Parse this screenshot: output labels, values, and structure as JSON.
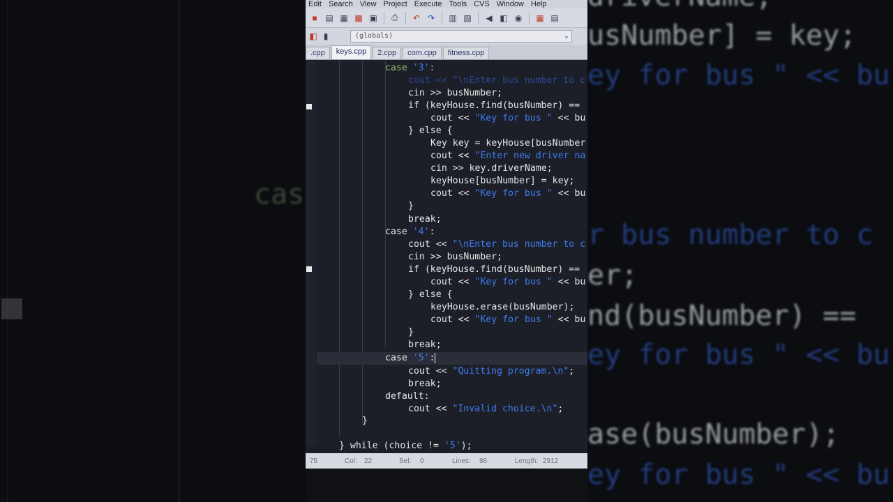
{
  "menu": {
    "items": [
      "Edit",
      "Search",
      "View",
      "Project",
      "Execute",
      "Tools",
      "CVS",
      "Window",
      "Help"
    ]
  },
  "toolbar": {
    "icons": [
      "new-file-icon",
      "open-icon",
      "save-icon",
      "save-all-icon",
      "close-icon",
      "print-icon",
      "undo-icon",
      "redo-icon",
      "indent-icon",
      "unindent-icon",
      "toggle-comment-icon",
      "find-icon",
      "compile-icon",
      "run-icon"
    ]
  },
  "classbar": {
    "scope": "(globals)"
  },
  "tabs": [
    {
      "label": ".cpp",
      "active": false
    },
    {
      "label": "keys.cpp",
      "active": true
    },
    {
      "label": "2.cpp",
      "active": false
    },
    {
      "label": "com.cpp",
      "active": false
    },
    {
      "label": "fitness.cpp",
      "active": false
    }
  ],
  "code": {
    "lines": [
      "case '3':",
      "cout << \"\\nEnter bus number to c",
      "cin >> busNumber;",
      "if (keyHouse.find(busNumber) ==",
      "cout << \"Key for bus \" << bu",
      "} else {",
      "Key key = keyHouse[busNumber",
      "cout << \"Enter new driver na",
      "cin >> key.driverName;",
      "keyHouse[busNumber] = key;",
      "cout << \"Key for bus \" << bu",
      "}",
      "break;",
      "case '4':",
      "cout << \"\\nEnter bus number to c",
      "cin >> busNumber;",
      "if (keyHouse.find(busNumber) ==",
      "cout << \"Key for bus \" << bu",
      "} else {",
      "keyHouse.erase(busNumber);",
      "cout << \"Key for bus \" << bu",
      "}",
      "break;",
      "case '5':",
      "cout << \"Quitting program.\\n\";",
      "break;",
      "default:",
      "cout << \"Invalid choice.\\n\";",
      "}",
      "} while (choice != '5');"
    ]
  },
  "status": {
    "line": "75",
    "col_label": "Col:",
    "col": "22",
    "sel_label": "Sel:",
    "sel": "0",
    "lines_label": "Lines:",
    "lines": "86",
    "length_label": "Length:",
    "length": "2912"
  },
  "background": {
    "left_text": "cas",
    "right_lines": [
      "driverName;",
      "usNumber] = key;",
      "ey for bus \" << bu",
      "r bus number to c",
      "er;",
      "nd(busNumber) ==",
      "ey for bus \" << bu",
      "ase(busNumber);",
      "ey for bus \" << bu"
    ]
  },
  "colors": {
    "editor_bg": "#1c1f27",
    "string": "#3f7cf0",
    "keyword": "#cfd4e6"
  }
}
